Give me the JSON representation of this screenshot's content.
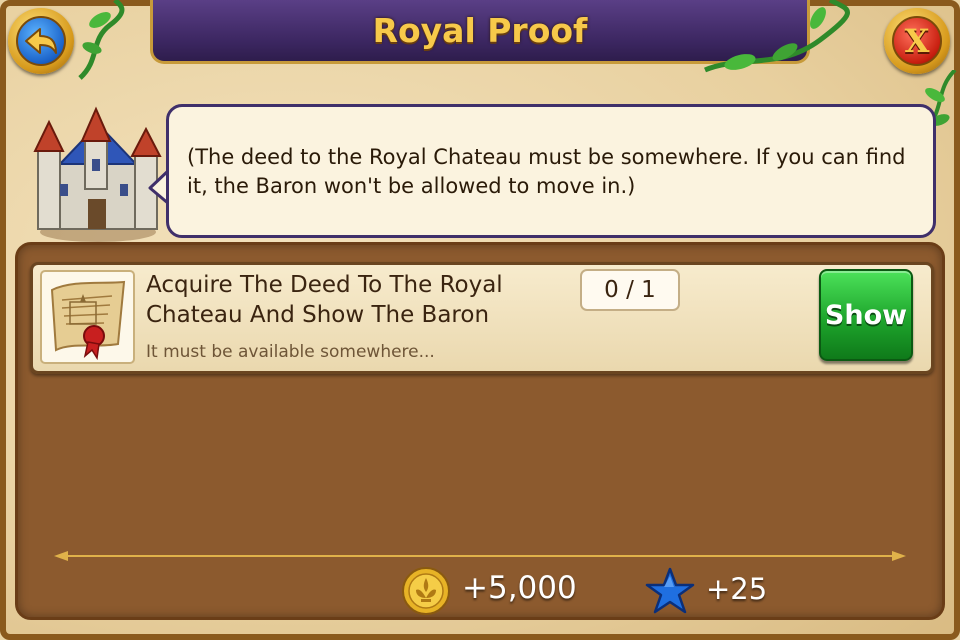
{
  "title": "Royal Proof",
  "nav": {
    "back_icon": "back-arrow-icon",
    "close_icon": "close-x-icon",
    "close_glyph": "X"
  },
  "dialogue": {
    "text": "(The deed to the Royal Chateau must be somewhere. If you can find it, the Baron won't be allowed to move in.)",
    "speaker_image": "royal-chateau-icon"
  },
  "task": {
    "icon": "deed-scroll-icon",
    "title": "Acquire The Deed To The Royal Chateau And Show The Baron",
    "subtitle": "It must be available somewhere...",
    "progress": "0 / 1",
    "progress_current": 0,
    "progress_total": 1,
    "action_label": "Show"
  },
  "rewards": {
    "coins_icon": "gold-coin-icon",
    "coins": "+5,000",
    "xp_icon": "blue-star-icon",
    "xp": "+25"
  },
  "colors": {
    "title_text": "#f7c94a",
    "title_bar": "#3b2660",
    "panel_brown": "#8c5a2e",
    "parchment": "#e9d3a4",
    "show_button": "#1ea52c",
    "back_button": "#1b63c9",
    "close_button": "#c81f10"
  }
}
